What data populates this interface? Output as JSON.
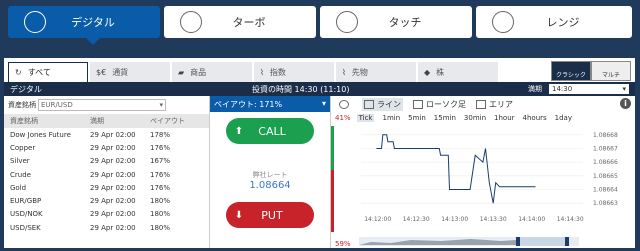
{
  "mode_tabs": [
    {
      "label": "デジタル",
      "icon": "target-icon"
    },
    {
      "label": "ターボ",
      "icon": "stopwatch-icon"
    },
    {
      "label": "タッチ",
      "icon": "crosshair-icon"
    },
    {
      "label": "レンジ",
      "icon": "trend-icon"
    }
  ],
  "category_tabs": [
    {
      "label": "すべて",
      "icon": "refresh-icon"
    },
    {
      "label": "通貨",
      "icon": "currency-icon"
    },
    {
      "label": "商品",
      "icon": "gold-bars-icon"
    },
    {
      "label": "指数",
      "icon": "index-chart-icon"
    },
    {
      "label": "先物",
      "icon": "futures-chart-icon"
    },
    {
      "label": "株",
      "icon": "stock-icon"
    }
  ],
  "view_buttons": {
    "classic": "クラシック",
    "multi": "マルチ"
  },
  "subbar": {
    "mode": "デジタル",
    "invest_time": "投資の時間 14:30 (11:10)",
    "expiry_label": "満期",
    "expiry_value": "14:30"
  },
  "asset_filter": {
    "label": "資産銘柄",
    "value": "EUR/USD"
  },
  "asset_table": {
    "headers": [
      "資産銘柄",
      "満期",
      "ペイアウト"
    ],
    "rows": [
      [
        "Dow Jones Future",
        "29 Apr 02:00",
        "178%"
      ],
      [
        "Copper",
        "29 Apr 02:00",
        "176%"
      ],
      [
        "Silver",
        "29 Apr 02:00",
        "167%"
      ],
      [
        "Crude",
        "29 Apr 02:00",
        "176%"
      ],
      [
        "Gold",
        "29 Apr 02:00",
        "176%"
      ],
      [
        "EUR/GBP",
        "29 Apr 02:00",
        "180%"
      ],
      [
        "USD/NOK",
        "29 Apr 02:00",
        "180%"
      ],
      [
        "USD/SEK",
        "29 Apr 02:00",
        "180%"
      ]
    ]
  },
  "trade": {
    "payout": "ペイアウト: 171%",
    "call_label": "CALL",
    "put_label": "PUT",
    "rate_label": "弊社レート",
    "rate_value": "1.08664"
  },
  "chart_tools": {
    "line": "ライン",
    "candle": "ローソク足",
    "area": "エリア",
    "info": "i"
  },
  "timeframes": {
    "call_pct": "41%",
    "put_pct": "59%",
    "items": [
      "Tick",
      "1min",
      "5min",
      "15min",
      "30min",
      "1hour",
      "4hours",
      "1day"
    ]
  },
  "chart_data": {
    "type": "line",
    "x_ticks": [
      "14:12:00",
      "14:12:30",
      "14:13:00",
      "14:13:30",
      "14:14:00",
      "14:14:30"
    ],
    "y_ticks": [
      "1.08668",
      "1.08667",
      "1.08666",
      "1.08665",
      "1.08664",
      "1.08663"
    ],
    "ylim": [
      1.086625,
      1.086685
    ],
    "series": [
      {
        "x": [
          "14:11:59",
          "14:12:03",
          "14:12:04",
          "14:12:07",
          "14:12:08",
          "14:12:12",
          "14:12:13",
          "14:12:48",
          "14:12:49",
          "14:12:55",
          "14:12:56",
          "14:13:12",
          "14:13:16",
          "14:13:22",
          "14:13:24",
          "14:13:27",
          "14:13:30",
          "14:13:32",
          "14:13:35",
          "14:14:03"
        ],
        "y": [
          1.08667,
          1.08667,
          1.08668,
          1.08668,
          1.086675,
          1.086675,
          1.08667,
          1.08667,
          1.086665,
          1.086665,
          1.08664,
          1.08664,
          1.086665,
          1.08666,
          1.08667,
          1.086645,
          1.08663,
          1.086645,
          1.086642,
          1.086642
        ],
        "color": "#1a3d6a"
      }
    ],
    "grid": true
  },
  "colors": {
    "accent": "#0a5ba8",
    "navy": "#1a2e4a",
    "call": "#1aa04f",
    "put": "#c8222a"
  }
}
